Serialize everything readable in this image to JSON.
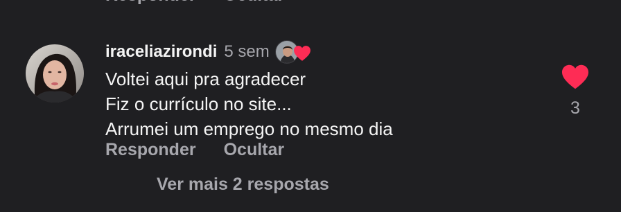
{
  "previous_comment": {
    "reply_label": "Responder",
    "hide_label": "Ocultar"
  },
  "comment": {
    "username": "iraceliazirondi",
    "timestamp": "5 sem",
    "creator_liked": true,
    "text_lines": [
      "Voltei aqui pra agradecer",
      "Fiz o currículo no site...",
      "Arrumei um emprego no mesmo dia"
    ],
    "reply_label": "Responder",
    "hide_label": "Ocultar",
    "like_count": "3",
    "liked": true,
    "view_replies_label": "Ver mais 2 respostas"
  },
  "icons": {
    "avatar": "user-avatar",
    "creator_avatar": "creator-avatar",
    "creator_heart": "heart-filled-icon",
    "like": "heart-filled-icon"
  },
  "colors": {
    "background": "#1f1f22",
    "primary_text": "#f4f4f4",
    "secondary_text": "#a7a7ad",
    "heart": "#fe2c55"
  }
}
